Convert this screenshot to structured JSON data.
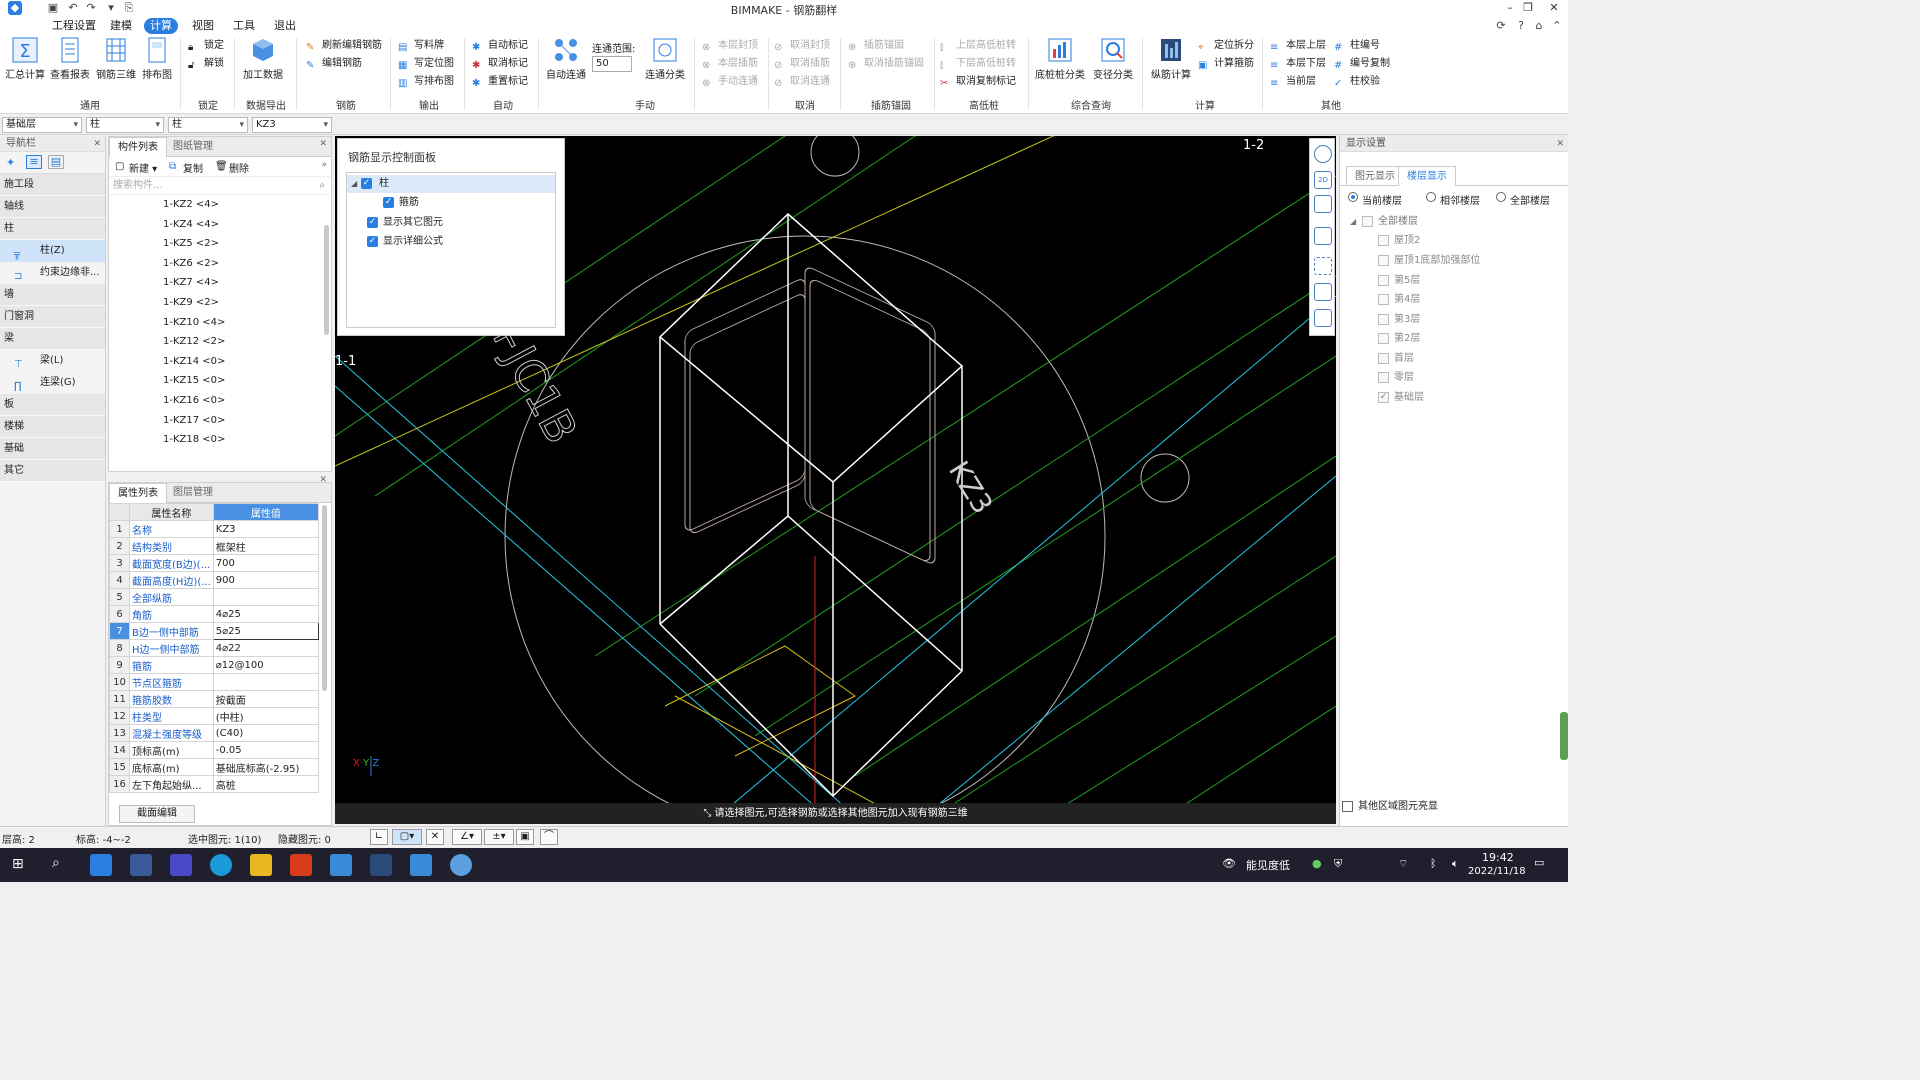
{
  "window": {
    "title": "BIMMAKE - 钢筋翻样"
  },
  "menu": {
    "items": [
      "工程设置",
      "建模",
      "计算",
      "视图",
      "工具",
      "退出"
    ],
    "active": "计算"
  },
  "ribbon": {
    "big": [
      "汇总计算",
      "查看报表",
      "钢筋三维",
      "排布图",
      "加工数据",
      "自动连通",
      "连通分类",
      "底桩桩分类",
      "变径分类",
      "纵筋计算"
    ],
    "lock": [
      "锁定",
      "解锁"
    ],
    "rebar": [
      "刷新编辑钢筋",
      "编辑钢筋"
    ],
    "output": [
      "写料牌",
      "写定位图",
      "写排布图"
    ],
    "auto": [
      "自动标记",
      "取消标记",
      "重置标记"
    ],
    "link_label": "连通范围:",
    "link_value": "50",
    "manual": [
      "本层封顶",
      "本层插筋",
      "手动连通"
    ],
    "cancel": [
      "取消封顶",
      "取消插筋",
      "取消连通"
    ],
    "anchor": [
      "插筋锚固",
      "取消插筋锚固"
    ],
    "pile": [
      "上层高低桩转",
      "下层高低桩转",
      "取消复制标记"
    ],
    "calc": [
      "定位拆分",
      "计算箍筋"
    ],
    "other": [
      "本层上层",
      "本层下层",
      "当前层",
      "柱编号",
      "编号复制",
      "柱校验"
    ],
    "groups": [
      "通用",
      "锁定",
      "数据导出",
      "钢筋",
      "输出",
      "自动",
      "手动",
      "取消",
      "插筋锚固",
      "高低桩",
      "综合查询",
      "计算",
      "其他"
    ]
  },
  "combos": [
    "基础层",
    "柱",
    "柱",
    "KZ3"
  ],
  "nav": {
    "title": "导航栏",
    "cats": [
      "施工段",
      "轴线",
      "柱",
      "墙",
      "门窗洞",
      "梁",
      "板",
      "楼梯",
      "基础",
      "其它"
    ],
    "items": [
      "柱(Z)",
      "约束边缘非...",
      "梁(L)",
      "连梁(G)"
    ]
  },
  "comp": {
    "tabs": [
      "构件列表",
      "图纸管理"
    ],
    "tools": [
      "新建",
      "复制",
      "删除"
    ],
    "search": "搜索构件...",
    "items": [
      "1-KZ2 <4>",
      "1-KZ4 <4>",
      "1-KZ5 <2>",
      "1-KZ6 <2>",
      "1-KZ7 <4>",
      "1-KZ9 <2>",
      "1-KZ10 <4>",
      "1-KZ12 <2>",
      "1-KZ14 <0>",
      "1-KZ15 <0>",
      "1-KZ16 <0>",
      "1-KZ17 <0>",
      "1-KZ18 <0>"
    ]
  },
  "prop": {
    "tabs": [
      "属性列表",
      "图层管理"
    ],
    "head": [
      "属性名称",
      "属性值"
    ],
    "rows": [
      {
        "n": "1",
        "k": "名称",
        "v": "KZ3"
      },
      {
        "n": "2",
        "k": "结构类别",
        "v": "框架柱"
      },
      {
        "n": "3",
        "k": "截面宽度(B边)(...",
        "v": "700"
      },
      {
        "n": "4",
        "k": "截面高度(H边)(...",
        "v": "900"
      },
      {
        "n": "5",
        "k": "全部纵筋",
        "v": ""
      },
      {
        "n": "6",
        "k": "角筋",
        "v": "4⌀25"
      },
      {
        "n": "7",
        "k": "B边一侧中部筋",
        "v": "5⌀25"
      },
      {
        "n": "8",
        "k": "H边一侧中部筋",
        "v": "4⌀22"
      },
      {
        "n": "9",
        "k": "箍筋",
        "v": "⌀12@100"
      },
      {
        "n": "10",
        "k": "节点区箍筋",
        "v": ""
      },
      {
        "n": "11",
        "k": "箍筋胶数",
        "v": "按截面"
      },
      {
        "n": "12",
        "k": "柱类型",
        "v": "(中柱)"
      },
      {
        "n": "13",
        "k": "混凝土强度等级",
        "v": "(C40)"
      },
      {
        "n": "14",
        "k": "顶标高(m)",
        "v": "-0.05"
      },
      {
        "n": "15",
        "k": "底标高(m)",
        "v": "基础底标高(-2.95)"
      },
      {
        "n": "16",
        "k": "左下角起始纵...",
        "v": "高桩"
      }
    ],
    "section_btn": "截面编辑"
  },
  "ctrl": {
    "title": "钢筋显示控制面板",
    "items": [
      "柱",
      "箍筋",
      "显示其它图元",
      "显示详细公式"
    ]
  },
  "viewport": {
    "labels": [
      "1-2",
      "1-1",
      "KZ3",
      "+JC1B"
    ],
    "hint": "请选择图元,可选择钢筋或选择其他图元加入现有钢筋三维"
  },
  "disp": {
    "title": "显示设置",
    "tabs": [
      "图元显示",
      "楼层显示"
    ],
    "radios": [
      "当前楼层",
      "相邻楼层",
      "全部楼层"
    ],
    "tree_root": "全部楼层",
    "floors": [
      "屋顶2",
      "屋顶1底部加强部位",
      "第5层",
      "第4层",
      "第3层",
      "第2层",
      "首层",
      "零层",
      "基础层"
    ],
    "other": "其他区域图元亮显"
  },
  "status": {
    "floor": "层高:  2",
    "elev": "标高:  -4~-2",
    "sel": "选中图元: 1(10)",
    "hidden": "隐藏图元: 0"
  },
  "taskbar": {
    "ime": "能见度低",
    "time": "19:42",
    "date": "2022/11/18"
  }
}
